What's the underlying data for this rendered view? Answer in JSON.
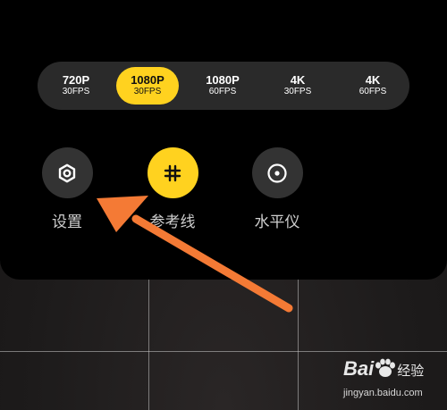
{
  "resolutions": [
    {
      "main": "720P",
      "sub": "30FPS",
      "selected": false
    },
    {
      "main": "1080P",
      "sub": "30FPS",
      "selected": true
    },
    {
      "main": "1080P",
      "sub": "60FPS",
      "selected": false
    },
    {
      "main": "4K",
      "sub": "30FPS",
      "selected": false
    },
    {
      "main": "4K",
      "sub": "60FPS",
      "selected": false
    }
  ],
  "options": {
    "settings": {
      "label": "设置",
      "icon": "gear-icon"
    },
    "grid": {
      "label": "参考线",
      "icon": "grid-icon",
      "active": true
    },
    "level": {
      "label": "水平仪",
      "icon": "level-icon"
    }
  },
  "watermark": {
    "brand_left": "Bai",
    "brand_right": "经验",
    "url": "jingyan.baidu.com"
  },
  "colors": {
    "accent": "#ffd21f",
    "panel": "#000000",
    "pill_bar": "#2a2a2a",
    "button": "#333333",
    "arrow": "#f47a35"
  }
}
